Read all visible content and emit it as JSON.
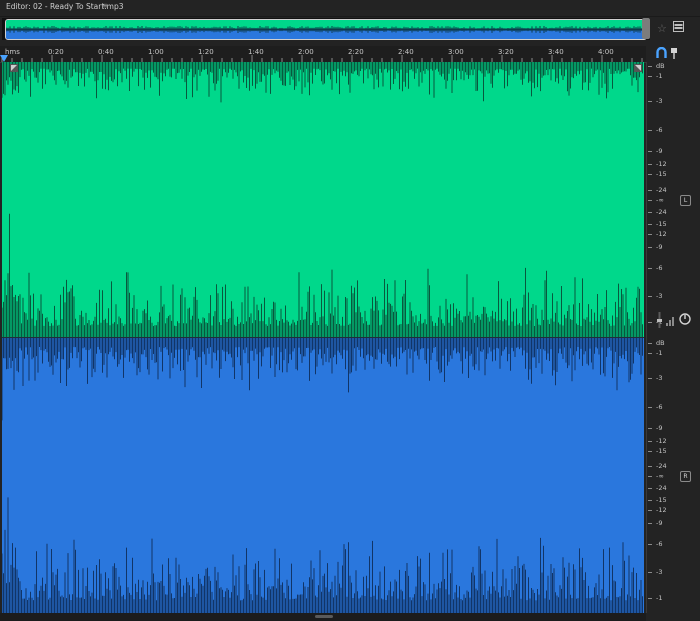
{
  "editor": {
    "title": "Editor: 02 - Ready To Start.mp3",
    "menu_glyph": "≡"
  },
  "ruler": {
    "unit": "hms",
    "ticks": [
      "0:20",
      "0:40",
      "1:00",
      "1:20",
      "1:40",
      "2:00",
      "2:20",
      "2:40",
      "3:00",
      "3:20",
      "3:40",
      "4:00"
    ]
  },
  "channels": {
    "left": {
      "tag": "L",
      "color": "#00d88b",
      "db_labels": [
        "dB",
        "-1",
        "-3",
        "-6",
        "-9",
        "-12",
        "-15",
        "-24",
        "-∞",
        "-24",
        "-15",
        "-12",
        "-9",
        "-6",
        "-3",
        "-1"
      ]
    },
    "right": {
      "tag": "R",
      "color": "#2a77dd",
      "db_labels": [
        "dB",
        "-1",
        "-3",
        "-6",
        "-9",
        "-12",
        "-15",
        "-24",
        "-∞",
        "-24",
        "-15",
        "-12",
        "-9",
        "-6",
        "-3",
        "-1"
      ]
    }
  },
  "icons": {
    "zoom": "zoom-icon",
    "panel": "panel-layout-icon",
    "snap": "magnet-icon",
    "marker": "marker-icon",
    "volume": "volume-knob-icon",
    "levels": "level-meter-icon"
  },
  "colors": {
    "background": "#232323",
    "playhead": "#4aa3ff"
  }
}
